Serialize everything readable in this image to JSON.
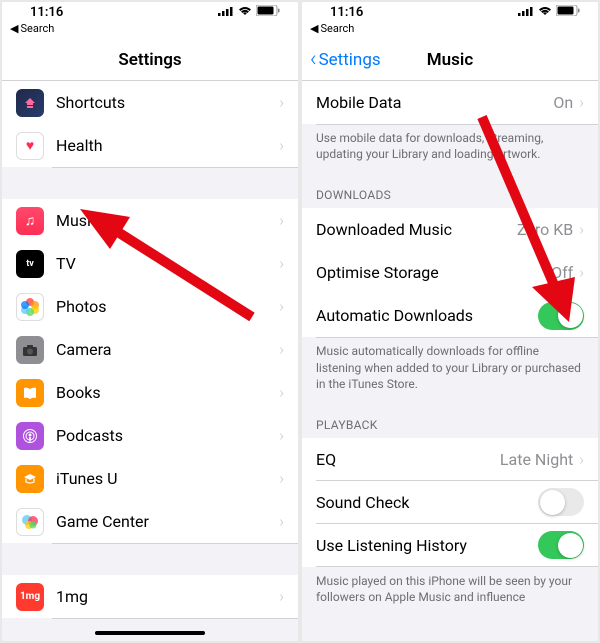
{
  "status": {
    "time": "11:16",
    "back_label": "Search"
  },
  "left": {
    "title": "Settings",
    "rows_group1": [
      {
        "name": "shortcuts",
        "label": "Shortcuts",
        "icon": "shortcuts"
      },
      {
        "name": "health",
        "label": "Health",
        "icon": "health"
      }
    ],
    "rows_group2": [
      {
        "name": "music",
        "label": "Music",
        "icon": "music"
      },
      {
        "name": "tv",
        "label": "TV",
        "icon": "tv"
      },
      {
        "name": "photos",
        "label": "Photos",
        "icon": "photos"
      },
      {
        "name": "camera",
        "label": "Camera",
        "icon": "camera"
      },
      {
        "name": "books",
        "label": "Books",
        "icon": "books"
      },
      {
        "name": "podcasts",
        "label": "Podcasts",
        "icon": "podcasts"
      },
      {
        "name": "itunesu",
        "label": "iTunes U",
        "icon": "itunesu"
      },
      {
        "name": "gamecenter",
        "label": "Game Center",
        "icon": "gamecenter"
      }
    ],
    "rows_group3": [
      {
        "name": "1mg",
        "label": "1mg",
        "icon": "1mg"
      }
    ]
  },
  "right": {
    "back_label": "Settings",
    "title": "Music",
    "mobile_data": {
      "label": "Mobile Data",
      "value": "On"
    },
    "mobile_data_footer": "Use mobile data for downloads, streaming, updating your Library and loading artwork.",
    "downloads_header": "DOWNLOADS",
    "downloaded_music": {
      "label": "Downloaded Music",
      "value": "Zero KB"
    },
    "optimise_storage": {
      "label": "Optimise Storage",
      "value": "Off"
    },
    "automatic_downloads": {
      "label": "Automatic Downloads",
      "state": "on"
    },
    "downloads_footer": "Music automatically downloads for offline listening when added to your Library or purchased in the iTunes Store.",
    "playback_header": "PLAYBACK",
    "eq": {
      "label": "EQ",
      "value": "Late Night"
    },
    "sound_check": {
      "label": "Sound Check",
      "state": "off"
    },
    "listening_history": {
      "label": "Use Listening History",
      "state": "on"
    },
    "playback_footer": "Music played on this iPhone will be seen by your followers on Apple Music and influence"
  },
  "icons": {
    "signal": "signal-icon",
    "wifi": "wifi-icon",
    "battery": "battery-icon"
  }
}
